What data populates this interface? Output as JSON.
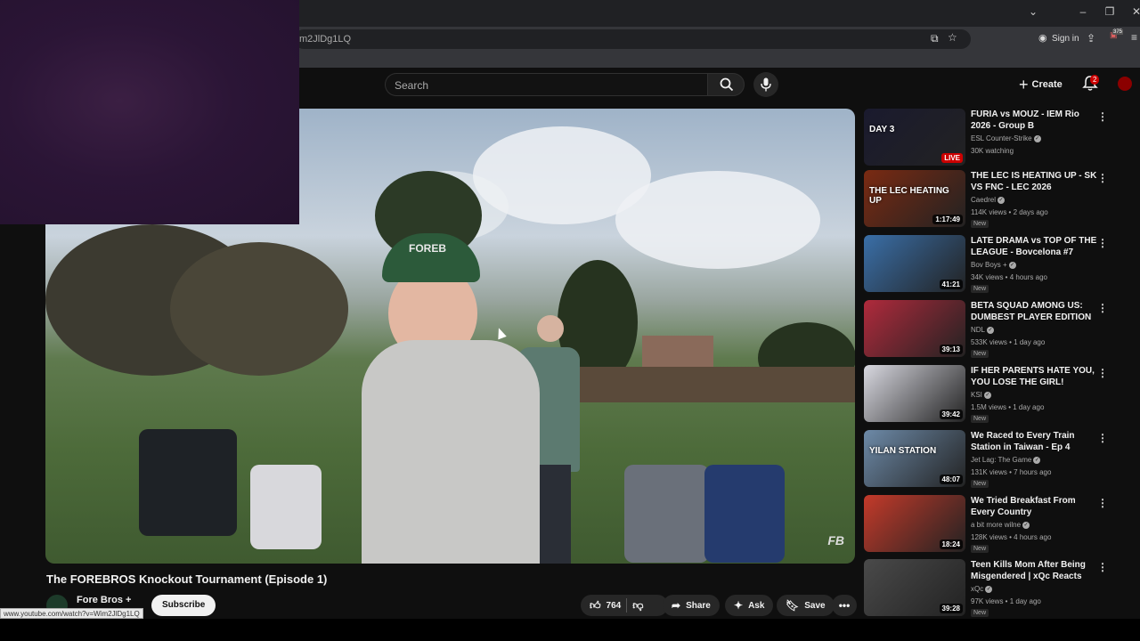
{
  "browser": {
    "url": "m2JlDg1LQ",
    "sign_in": "Sign in",
    "ext_badge": "375",
    "status_url": "www.youtube.com/watch?v=Wim2JlDg1LQ"
  },
  "masthead": {
    "search_placeholder": "Search",
    "create_label": "Create",
    "notifications_count": "2"
  },
  "video": {
    "title": "The FOREBROS Knockout Tournament (Episode 1)",
    "channel": "Fore Bros +",
    "subscribe_label": "Subscribe",
    "likes": "764",
    "share_label": "Share",
    "ask_label": "Ask",
    "save_label": "Save",
    "cap_text": "FOREB"
  },
  "recommendations": [
    {
      "title": "FURIA vs MOUZ - IEM Rio 2026 - Group B",
      "channel": "ESL Counter-Strike",
      "meta": "30K watching",
      "badge": "",
      "overlay": "LIVE",
      "thumb_text": "DAY 3",
      "color": "#1a1a2e"
    },
    {
      "title": "THE LEC IS HEATING UP - SK VS FNC - LEC 2026",
      "channel": "Caedrel",
      "meta": "114K views • 2 days ago",
      "badge": "New",
      "overlay": "1:17:49",
      "thumb_text": "THE LEC HEATING UP",
      "color": "#7a2a12"
    },
    {
      "title": "LATE DRAMA vs TOP OF THE LEAGUE - Bovcelona #7",
      "channel": "Bov Boys +",
      "meta": "34K views • 4 hours ago",
      "badge": "New",
      "overlay": "41:21",
      "thumb_text": "",
      "color": "#3a6fa8"
    },
    {
      "title": "BETA SQUAD AMONG US: DUMBEST PLAYER EDITION",
      "channel": "NDL",
      "meta": "533K views • 1 day ago",
      "badge": "New",
      "overlay": "39:13",
      "thumb_text": "",
      "color": "#b02a3c"
    },
    {
      "title": "IF HER PARENTS HATE YOU, YOU LOSE THE GIRL!",
      "channel": "KSI",
      "meta": "1.5M views • 1 day ago",
      "badge": "New",
      "overlay": "39:42",
      "thumb_text": "",
      "color": "#d8d8e0"
    },
    {
      "title": "We Raced to Every Train Station in Taiwan - Ep 4",
      "channel": "Jet Lag: The Game",
      "meta": "131K views • 7 hours ago",
      "badge": "New",
      "overlay": "48:07",
      "thumb_text": "YILAN STATION",
      "color": "#6d8aa8"
    },
    {
      "title": "We Tried Breakfast From Every Country",
      "channel": "a bit more wilne",
      "meta": "128K views • 4 hours ago",
      "badge": "New",
      "overlay": "18:24",
      "thumb_text": "",
      "color": "#c43a2a"
    },
    {
      "title": "Teen Kills Mom After Being Misgendered | xQc Reacts",
      "channel": "xQc",
      "meta": "97K views • 1 day ago",
      "badge": "New",
      "overlay": "39:28",
      "thumb_text": "",
      "color": "#4a4a4a"
    }
  ]
}
